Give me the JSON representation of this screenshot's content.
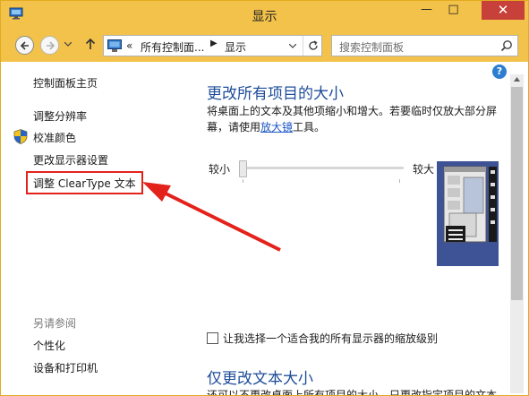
{
  "window": {
    "title": "显示"
  },
  "titlebar": {
    "min_glyph": "—",
    "max_glyph": "□",
    "close_glyph": "✕"
  },
  "address": {
    "chevron": "«",
    "segment1": "所有控制面...",
    "separator": "▶",
    "segment2": "显示"
  },
  "search": {
    "placeholder": "搜索控制面板"
  },
  "sidebar": {
    "home": "控制面板主页",
    "items": [
      {
        "label": "调整分辨率"
      },
      {
        "label": "校准颜色"
      },
      {
        "label": "更改显示器设置"
      },
      {
        "label": "调整 ClearType 文本"
      }
    ],
    "see_also": "另请参阅",
    "see_also_items": [
      {
        "label": "个性化"
      },
      {
        "label": "设备和打印机"
      }
    ]
  },
  "main": {
    "heading": "更改所有项目的大小",
    "desc_part1": "将桌面上的文本及其他项缩小和增大。若要临时仅放大部分屏幕，请使用",
    "desc_link": "放大镜",
    "desc_part2": "工具。",
    "slider": {
      "small_label": "较小",
      "large_label": "较大",
      "level": 0
    },
    "checkbox_label": "让我选择一个适合我的所有显示器的缩放级别",
    "checkbox_checked": false,
    "heading2": "仅更改文本大小",
    "cut_text": "还可以不更改桌面上所有项目的大小，只更改指定项目的文本"
  },
  "help": {
    "glyph": "?"
  },
  "colors": {
    "titlebar": "#f2c24a",
    "heading": "#1e4c9a",
    "link": "#1a56c2",
    "highlight": "#e3231b",
    "close": "#c7403a"
  }
}
